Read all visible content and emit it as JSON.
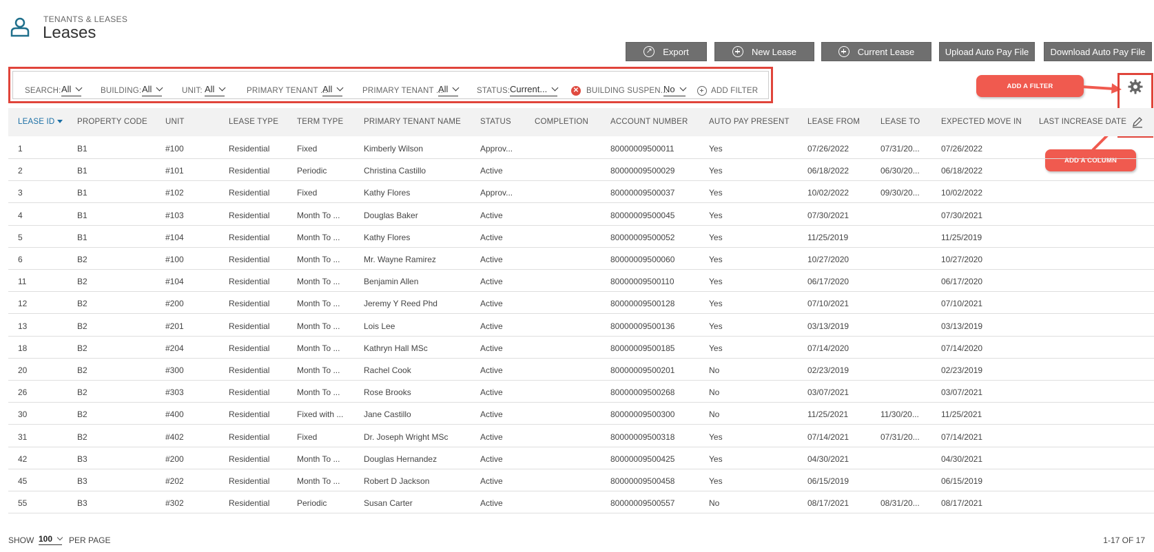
{
  "header": {
    "section_label": "TENANTS & LEASES",
    "title": "Leases",
    "icon": "user-icon"
  },
  "toolbar": {
    "export": "Export",
    "new_lease": "New Lease",
    "current_lease": "Current Lease",
    "upload": "Upload Auto Pay File",
    "download": "Download Auto Pay File"
  },
  "filters": {
    "search": {
      "label": "SEARCH:",
      "value": "All"
    },
    "building": {
      "label": "BUILDING:",
      "value": "All"
    },
    "unit": {
      "label": "UNIT:",
      "value": "All"
    },
    "primary_tenant_1": {
      "label": "PRIMARY TENANT ...",
      "value": "All"
    },
    "primary_tenant_2": {
      "label": "PRIMARY TENANT ...",
      "value": "All"
    },
    "status": {
      "label": "STATUS:",
      "value": "Current..."
    },
    "building_suspend": {
      "label": "BUILDING SUSPEN...",
      "value": "No"
    },
    "add_filter": "ADD FILTER"
  },
  "annotations": {
    "add_filter": "ADD A FILTER",
    "add_column": "ADD A COLUMN",
    "accent": "#f05a4f"
  },
  "columns": [
    "LEASE ID",
    "PROPERTY CODE",
    "UNIT",
    "LEASE TYPE",
    "TERM TYPE",
    "PRIMARY TENANT NAME",
    "STATUS",
    "COMPLETION",
    "ACCOUNT NUMBER",
    "AUTO PAY PRESENT",
    "LEASE FROM",
    "LEASE TO",
    "EXPECTED MOVE IN",
    "LAST INCREASE DATE"
  ],
  "rows": [
    [
      "1",
      "B1",
      "#100",
      "Residential",
      "Fixed",
      "Kimberly Wilson",
      "Approv...",
      "",
      "80000009500011",
      "Yes",
      "07/26/2022",
      "07/31/20...",
      "07/26/2022",
      ""
    ],
    [
      "2",
      "B1",
      "#101",
      "Residential",
      "Periodic",
      "Christina Castillo",
      "Active",
      "",
      "80000009500029",
      "Yes",
      "06/18/2022",
      "06/30/20...",
      "06/18/2022",
      ""
    ],
    [
      "3",
      "B1",
      "#102",
      "Residential",
      "Fixed",
      "Kathy Flores",
      "Approv...",
      "",
      "80000009500037",
      "Yes",
      "10/02/2022",
      "09/30/20...",
      "10/02/2022",
      ""
    ],
    [
      "4",
      "B1",
      "#103",
      "Residential",
      "Month To ...",
      "Douglas Baker",
      "Active",
      "",
      "80000009500045",
      "Yes",
      "07/30/2021",
      "",
      "07/30/2021",
      ""
    ],
    [
      "5",
      "B1",
      "#104",
      "Residential",
      "Month To ...",
      "Kathy Flores",
      "Active",
      "",
      "80000009500052",
      "Yes",
      "11/25/2019",
      "",
      "11/25/2019",
      ""
    ],
    [
      "6",
      "B2",
      "#100",
      "Residential",
      "Month To ...",
      "Mr. Wayne Ramirez",
      "Active",
      "",
      "80000009500060",
      "Yes",
      "10/27/2020",
      "",
      "10/27/2020",
      ""
    ],
    [
      "11",
      "B2",
      "#104",
      "Residential",
      "Month To ...",
      "Benjamin Allen",
      "Active",
      "",
      "80000009500110",
      "Yes",
      "06/17/2020",
      "",
      "06/17/2020",
      ""
    ],
    [
      "12",
      "B2",
      "#200",
      "Residential",
      "Month To ...",
      "Jeremy Y Reed Phd",
      "Active",
      "",
      "80000009500128",
      "Yes",
      "07/10/2021",
      "",
      "07/10/2021",
      ""
    ],
    [
      "13",
      "B2",
      "#201",
      "Residential",
      "Month To ...",
      "Lois Lee",
      "Active",
      "",
      "80000009500136",
      "Yes",
      "03/13/2019",
      "",
      "03/13/2019",
      ""
    ],
    [
      "18",
      "B2",
      "#204",
      "Residential",
      "Month To ...",
      "Kathryn Hall MSc",
      "Active",
      "",
      "80000009500185",
      "Yes",
      "07/14/2020",
      "",
      "07/14/2020",
      ""
    ],
    [
      "20",
      "B2",
      "#300",
      "Residential",
      "Month To ...",
      "Rachel Cook",
      "Active",
      "",
      "80000009500201",
      "No",
      "02/23/2019",
      "",
      "02/23/2019",
      ""
    ],
    [
      "26",
      "B2",
      "#303",
      "Residential",
      "Month To ...",
      "Rose Brooks",
      "Active",
      "",
      "80000009500268",
      "No",
      "03/07/2021",
      "",
      "03/07/2021",
      ""
    ],
    [
      "30",
      "B2",
      "#400",
      "Residential",
      "Fixed with ...",
      "Jane Castillo",
      "Active",
      "",
      "80000009500300",
      "No",
      "11/25/2021",
      "11/30/20...",
      "11/25/2021",
      ""
    ],
    [
      "31",
      "B2",
      "#402",
      "Residential",
      "Fixed",
      "Dr. Joseph Wright MSc",
      "Active",
      "",
      "80000009500318",
      "Yes",
      "07/14/2021",
      "07/31/20...",
      "07/14/2021",
      ""
    ],
    [
      "42",
      "B3",
      "#200",
      "Residential",
      "Month To ...",
      "Douglas Hernandez",
      "Active",
      "",
      "80000009500425",
      "Yes",
      "04/30/2021",
      "",
      "04/30/2021",
      ""
    ],
    [
      "45",
      "B3",
      "#202",
      "Residential",
      "Month To ...",
      "Robert D Jackson",
      "Active",
      "",
      "80000009500458",
      "Yes",
      "06/15/2019",
      "",
      "06/15/2019",
      ""
    ],
    [
      "55",
      "B3",
      "#302",
      "Residential",
      "Periodic",
      "Susan Carter",
      "Active",
      "",
      "80000009500557",
      "No",
      "08/17/2021",
      "08/31/20...",
      "08/17/2021",
      ""
    ]
  ],
  "footer": {
    "show": "SHOW",
    "per_page_value": "100",
    "per_page": "PER PAGE",
    "count": "1-17 OF 17"
  }
}
